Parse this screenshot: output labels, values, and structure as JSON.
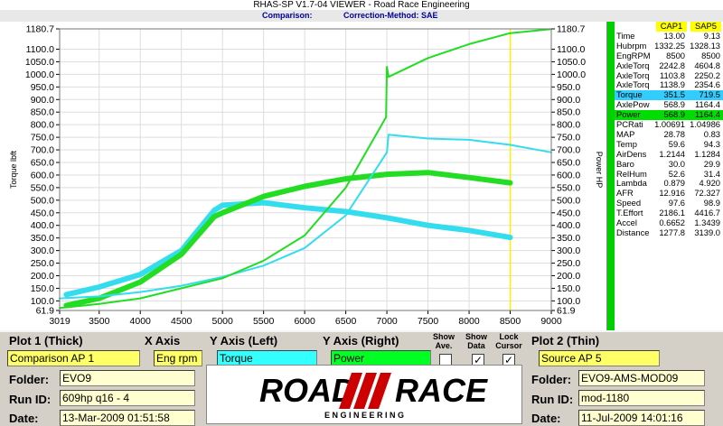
{
  "window": {
    "title": "RHAS-SP V1.7-04  VIEWER - Road Race Engineering",
    "comparison_label": "Comparison:",
    "correction_label": "Correction-Method: SAE"
  },
  "chart_data": {
    "type": "line",
    "xlim": [
      3019,
      9000
    ],
    "ylim": [
      61.9,
      1180.7
    ],
    "x_ticks": [
      "3019",
      "3500",
      "4000",
      "4500",
      "5000",
      "5500",
      "6000",
      "6500",
      "7000",
      "7500",
      "8000",
      "8500",
      "9000"
    ],
    "y_ticks": [
      "1180.7",
      "1100.0",
      "1050.0",
      "1000.0",
      "950.0",
      "900.0",
      "850.0",
      "800.0",
      "750.0",
      "700.0",
      "650.0",
      "600.0",
      "550.0",
      "500.0",
      "450.0",
      "400.0",
      "350.0",
      "300.0",
      "250.0",
      "200.0",
      "150.0",
      "100.0",
      "61.9"
    ],
    "ylabel_left": "Torque lbft",
    "ylabel_right": "Power HP",
    "cursor_x": 8500,
    "series": [
      {
        "color": "#33ddee",
        "thick": true,
        "x": [
          3100,
          3500,
          4000,
          4500,
          4900,
          5000,
          5500,
          6000,
          6500,
          7000,
          7500,
          8000,
          8500
        ],
        "values": [
          125,
          155,
          205,
          300,
          460,
          480,
          490,
          470,
          455,
          430,
          400,
          380,
          352
        ]
      },
      {
        "color": "#22dd22",
        "thick": true,
        "x": [
          3100,
          3500,
          4000,
          4500,
          4900,
          5000,
          5500,
          6000,
          6500,
          7000,
          7500,
          8000,
          8500
        ],
        "values": [
          82,
          110,
          175,
          285,
          435,
          450,
          515,
          555,
          585,
          603,
          610,
          590,
          569
        ]
      },
      {
        "color": "#33ddee",
        "thick": false,
        "x": [
          3019,
          3500,
          4000,
          4500,
          5000,
          5500,
          6000,
          6500,
          7000,
          7020,
          7500,
          8000,
          8500,
          9000
        ],
        "values": [
          110,
          118,
          135,
          160,
          195,
          240,
          310,
          440,
          690,
          760,
          745,
          740,
          720,
          690
        ]
      },
      {
        "color": "#22dd22",
        "thick": false,
        "x": [
          3019,
          3500,
          4000,
          4500,
          5000,
          5500,
          6000,
          6500,
          6990,
          7000,
          7020,
          7500,
          8000,
          8500,
          9000
        ],
        "values": [
          72,
          88,
          110,
          150,
          190,
          260,
          360,
          550,
          830,
          1030,
          990,
          1065,
          1120,
          1164,
          1180
        ]
      }
    ]
  },
  "data_table": {
    "headers": [
      "CAP1",
      "SAP5"
    ],
    "rows": [
      {
        "label": "Time",
        "v1": "13.00",
        "v2": "9.13",
        "highlight": ""
      },
      {
        "label": "Hubrpm",
        "v1": "1332.25",
        "v2": "1328.13",
        "highlight": ""
      },
      {
        "label": "EngRPM",
        "v1": "8500",
        "v2": "8500",
        "highlight": ""
      },
      {
        "label": "AxleTorq",
        "v1": "2242.8",
        "v2": "4604.8",
        "highlight": ""
      },
      {
        "label": "AxleTorq",
        "v1": "1103.8",
        "v2": "2250.2",
        "highlight": ""
      },
      {
        "label": "AxleTorq",
        "v1": "1138.9",
        "v2": "2354.6",
        "highlight": ""
      },
      {
        "label": "Torque",
        "v1": "351.5",
        "v2": "719.5",
        "highlight": "cyan"
      },
      {
        "label": "AxlePow",
        "v1": "568.9",
        "v2": "1164.4",
        "highlight": ""
      },
      {
        "label": "Power",
        "v1": "568.9",
        "v2": "1164.4",
        "highlight": "green"
      },
      {
        "label": "PCRati",
        "v1": "1.00691",
        "v2": "1.04986",
        "highlight": ""
      },
      {
        "label": "MAP",
        "v1": "28.78",
        "v2": "0.83",
        "highlight": ""
      },
      {
        "label": "Temp",
        "v1": "59.6",
        "v2": "94.3",
        "highlight": ""
      },
      {
        "label": "AirDens",
        "v1": "1.2144",
        "v2": "1.1284",
        "highlight": ""
      },
      {
        "label": "Baro",
        "v1": "30.0",
        "v2": "29.9",
        "highlight": ""
      },
      {
        "label": "RelHum",
        "v1": "52.6",
        "v2": "31.4",
        "highlight": ""
      },
      {
        "label": "Lambda",
        "v1": "0.879",
        "v2": "4.920",
        "highlight": ""
      },
      {
        "label": "AFR",
        "v1": "12.916",
        "v2": "72.327",
        "highlight": ""
      },
      {
        "label": "Speed",
        "v1": "97.6",
        "v2": "98.9",
        "highlight": ""
      },
      {
        "label": "T.Effort",
        "v1": "2186.1",
        "v2": "4416.7",
        "highlight": ""
      },
      {
        "label": "Accel",
        "v1": "0.6652",
        "v2": "1.3439",
        "highlight": ""
      },
      {
        "label": "Distance",
        "v1": "1277.8",
        "v2": "3139.0",
        "highlight": ""
      }
    ]
  },
  "controls": {
    "plot1_label": "Plot 1 (Thick)",
    "plot1_value": "Comparison AP 1",
    "x_axis_label": "X Axis",
    "x_axis_value": "Eng rpm",
    "y_left_label": "Y Axis (Left)",
    "y_left_value": "Torque",
    "y_right_label": "Y Axis (Right)",
    "y_right_value": "Power",
    "show_ave_label": "Show Ave.",
    "show_data_label": "Show Data",
    "lock_cursor_label": "Lock Cursor",
    "plot2_label": "Plot 2 (Thin)",
    "plot2_value": "Source AP 5",
    "folder_label": "Folder:",
    "run_id_label": "Run ID:",
    "date_label": "Date:",
    "folder1_value": "EVO9",
    "run_id1_value": "609hp q16 - 4",
    "date1_value": "13-Mar-2009  01:51:58",
    "folder2_value": "EVO9-AMS-MOD09",
    "run_id2_value": "mod-1180",
    "date2_value": "11-Jul-2009  14:01:16",
    "check_mark": "✓",
    "logo_word1": "ROAD",
    "logo_word2": "RACE",
    "logo_sub": "E N G I N E E R I N G"
  }
}
